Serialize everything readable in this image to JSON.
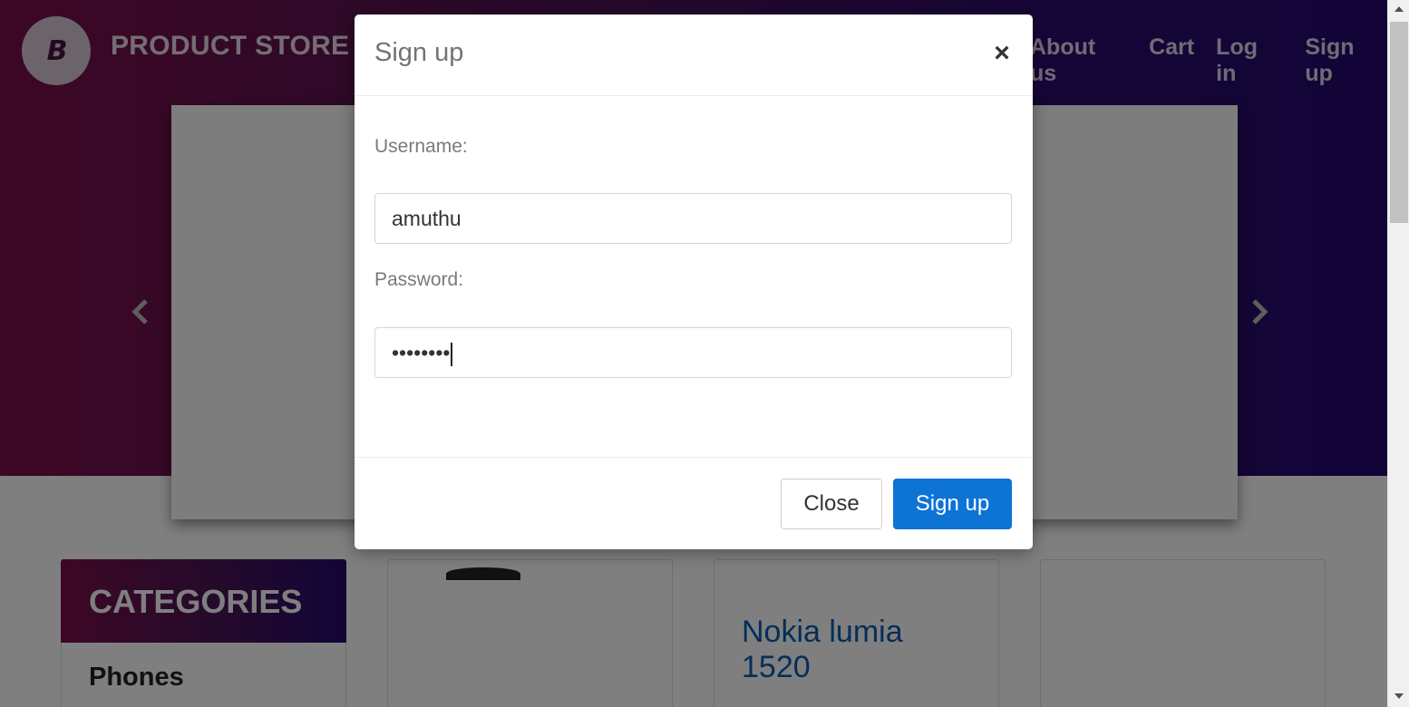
{
  "page": {
    "brand": "PRODUCT STORE",
    "logo_text": "B",
    "nav": [
      "About us",
      "Cart",
      "Log in",
      "Sign up"
    ],
    "categories_title": "CATEGORIES",
    "category_first": "Phones",
    "product_title": "Nokia lumia 1520"
  },
  "modal": {
    "title": "Sign up",
    "close_symbol": "×",
    "username_label": "Username:",
    "username_value": "amuthu",
    "password_label": "Password:",
    "password_masked": "••••••••",
    "close_button": "Close",
    "signup_button": "Sign up"
  },
  "colors": {
    "accent": "#0d74d6",
    "hero_start": "#7a0f4a",
    "hero_end": "#25096e"
  },
  "icons": [
    "carousel-prev-icon",
    "carousel-next-icon",
    "close-icon",
    "scroll-up-icon",
    "scroll-down-icon"
  ]
}
